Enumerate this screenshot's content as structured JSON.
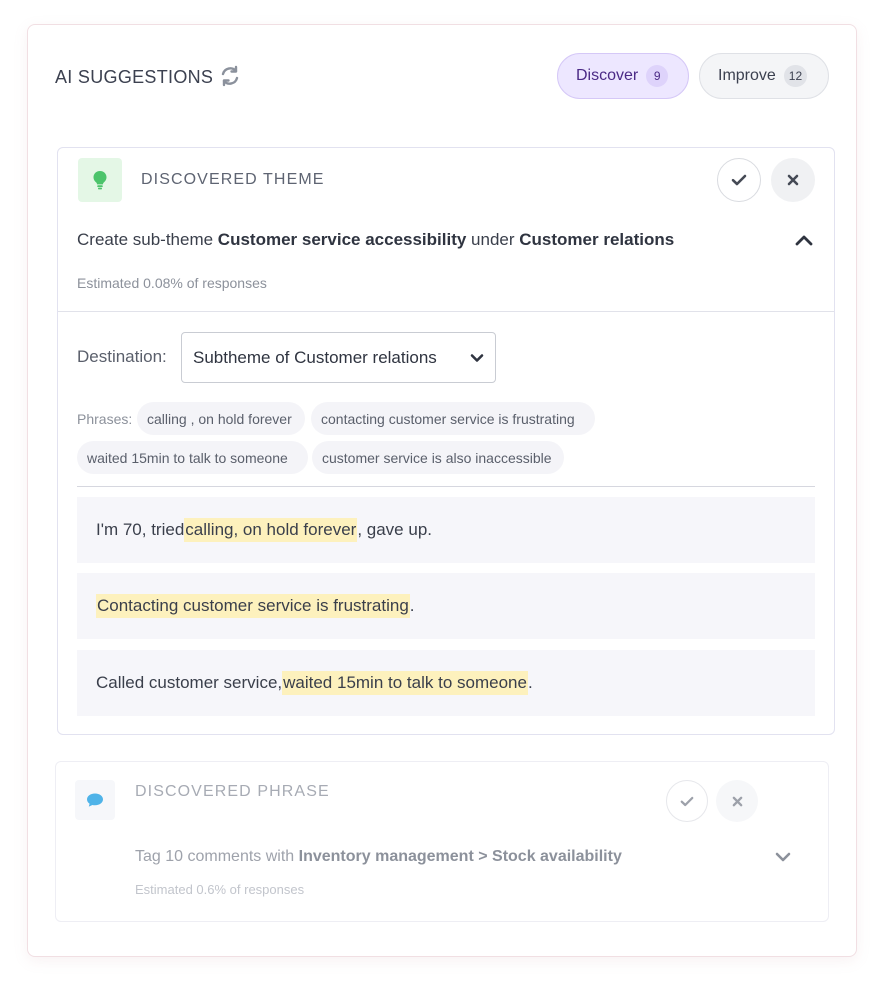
{
  "header": {
    "title": "AI SUGGESTIONS",
    "refresh_icon": "refresh-icon",
    "tabs": [
      {
        "label": "Discover",
        "count": "9",
        "active": true
      },
      {
        "label": "Improve",
        "count": "12",
        "active": false
      }
    ]
  },
  "theme_card": {
    "label": "DISCOVERED THEME",
    "icon": "lightbulb-icon",
    "line": {
      "prefix": "Create sub-theme ",
      "theme": "Customer service accessibility",
      "middle": " under ",
      "parent": "Customer relations"
    },
    "estimate": "Estimated 0.08% of responses",
    "destination_label": "Destination:",
    "destination_value": "Subtheme of Customer relations",
    "phrases_label": "Phrases:",
    "phrases": [
      "calling , on hold forever",
      "contacting customer service is frustrating",
      "waited 15min to talk to someone",
      "customer service is also inaccessible"
    ],
    "quotes": [
      {
        "before": "I'm 70, tried ",
        "highlight": "calling, on hold forever",
        "after": ", gave up."
      },
      {
        "before": "",
        "highlight": "Contacting customer service is frustrating",
        "after": "."
      },
      {
        "before": "Called customer service, ",
        "highlight": "waited 15min to talk to someone",
        "after": "."
      }
    ]
  },
  "phrase_card": {
    "label": "DISCOVERED PHRASE",
    "icon": "chat-bubble-icon",
    "line": {
      "prefix": "Tag 10 comments with ",
      "target": "Inventory management > Stock availability"
    },
    "estimate": "Estimated 0.6% of responses"
  },
  "colors": {
    "discover_pill_bg": "#ede7ff",
    "highlight": "#fdf1bd",
    "lightbulb": "#4cc46b",
    "chat_bubble": "#4fb3e8"
  }
}
